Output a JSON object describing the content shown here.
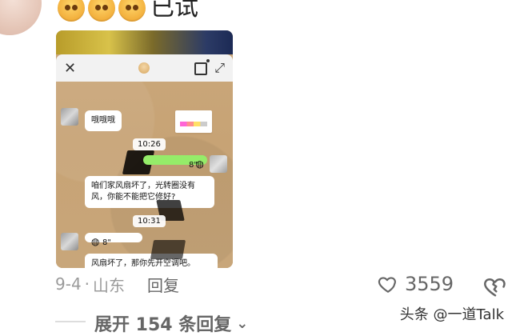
{
  "header": {
    "emoji_icon": "pensive-face-emoji",
    "emoji_count": 3,
    "text": "已试"
  },
  "screenshot": {
    "topbar": {
      "close_icon": "close-icon",
      "logo_icon": "dog-avatar-icon",
      "share_icon": "share-icon",
      "expand_icon": "expand-icon"
    },
    "chat": {
      "incoming_1": "哦哦哦",
      "time_1": "10:26",
      "outgoing_voice": "8\"",
      "incoming_2": "咱们家风扇坏了，光转圈没有风，你能不能把它修好?",
      "time_2": "10:31",
      "incoming_voice": "8\"",
      "incoming_3": "风扇坏了，那你先开空调吧。"
    }
  },
  "comment_meta": {
    "date": "9-4",
    "separator": "·",
    "location": "山东",
    "reply_label": "回复"
  },
  "reactions": {
    "like_icon": "heart-outline-icon",
    "like_count": "3559",
    "dislike_icon": "broken-heart-icon"
  },
  "replies": {
    "expand_label": "展开 154 条回复",
    "chevron_icon": "chevron-down-icon"
  },
  "watermark": "头条 @一道Talk",
  "colors": {
    "meta_gray": "#9a9a9a",
    "text_gray": "#666666",
    "chat_green": "#95ec69"
  }
}
